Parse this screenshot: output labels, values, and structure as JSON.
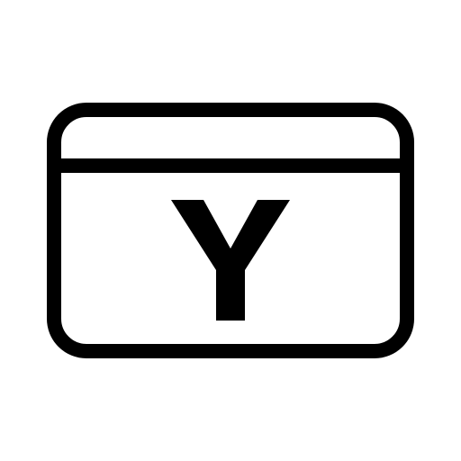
{
  "icon": {
    "name": "yen-card-icon",
    "letter": "Y",
    "stroke_color": "#000000",
    "background": "#ffffff"
  }
}
